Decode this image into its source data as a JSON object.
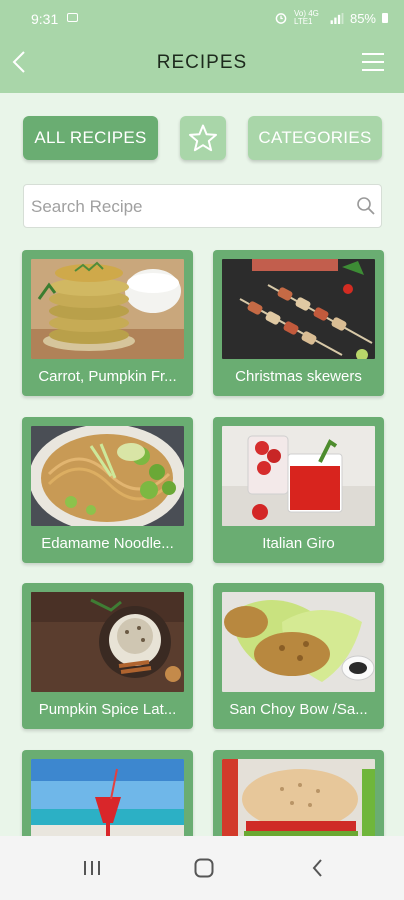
{
  "status_bar": {
    "time": "9:31",
    "net_text": "Vo) 4G LTE1",
    "battery": "85%"
  },
  "header": {
    "title": "RECIPES"
  },
  "buttons": {
    "all_recipes": "ALL RECIPES",
    "categories": "CATEGORIES"
  },
  "search": {
    "placeholder": "Search Recipe"
  },
  "recipes": [
    {
      "name": "Carrot, Pumpkin Fr..."
    },
    {
      "name": "Christmas skewers"
    },
    {
      "name": "Edamame Noodle..."
    },
    {
      "name": "Italian Giro"
    },
    {
      "name": "Pumpkin Spice Lat..."
    },
    {
      "name": "San Choy Bow /Sa..."
    },
    {
      "name": ""
    },
    {
      "name": ""
    }
  ],
  "colors": {
    "accent": "#6aad72",
    "header": "#a9d6a9",
    "background": "#e9f5e9"
  }
}
